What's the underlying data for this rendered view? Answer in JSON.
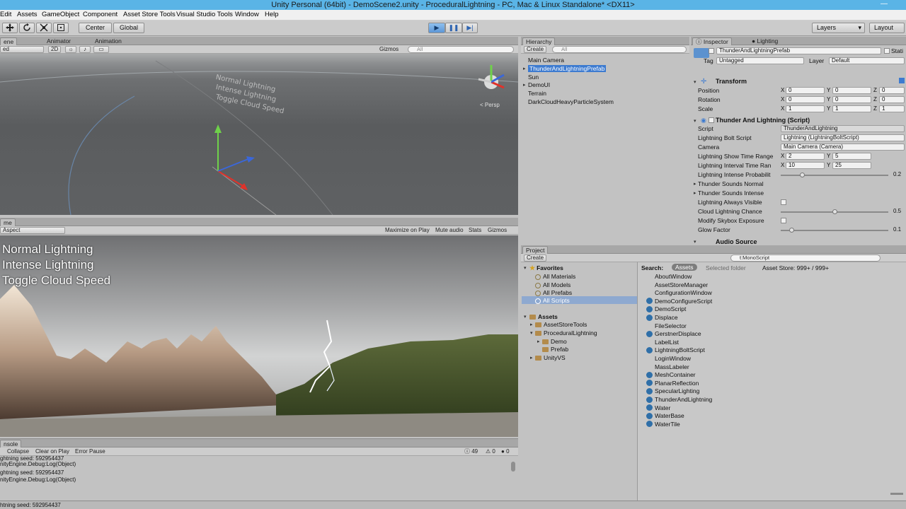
{
  "window": {
    "title": "Unity Personal (64bit) - DemoScene2.unity - ProceduralLightning - PC, Mac & Linux Standalone* <DX11>",
    "minimize": "—"
  },
  "menu": [
    "Edit",
    "Assets",
    "GameObject",
    "Component",
    "Asset Store Tools",
    "Visual Studio Tools",
    "Window",
    "Help"
  ],
  "toolbar": {
    "pivot": "Center",
    "space": "Global",
    "layers": "Layers",
    "layout": "Layout",
    "play_icon": "▶",
    "pause_icon": "❚❚",
    "step_icon": "▶|"
  },
  "scene": {
    "tabs": [
      "ene",
      "Animator",
      "Animation"
    ],
    "shading": "ed",
    "mode_2d": "2D",
    "gizmos": "Gizmos",
    "search_placeholder": "All",
    "labels": [
      "Normal Lightning",
      "Intense Lightning",
      "Toggle Cloud Speed"
    ],
    "persp": "< Persp"
  },
  "game": {
    "tab": "me",
    "aspect": "Aspect",
    "options": [
      "Maximize on Play",
      "Mute audio",
      "Stats",
      "Gizmos"
    ],
    "overlay": [
      "Normal Lightning",
      "Intense Lightning",
      "Toggle Cloud Speed"
    ]
  },
  "console": {
    "tab": "nsole",
    "buttons": [
      "Collapse",
      "Clear on Play",
      "Error Pause"
    ],
    "counts": {
      "info": "49",
      "warn": "0",
      "error": "0"
    },
    "lines": [
      "ghtning seed: 592954437",
      "nityEngine.Debug:Log(Object)",
      "ghtning seed: 592954437",
      "nityEngine.Debug:Log(Object)"
    ],
    "status": "htning seed: 592954437"
  },
  "hierarchy": {
    "tab": "Hierarchy",
    "create": "Create",
    "search_placeholder": "All",
    "items": [
      "Main Camera",
      "ThunderAndLightningPrefab",
      "Sun",
      "DemoUI",
      "Terrain",
      "DarkCloudHeavyParticleSystem"
    ],
    "selected_index": 1
  },
  "inspector": {
    "tabs": [
      "Inspector",
      "Lighting"
    ],
    "object_name": "ThunderAndLightningPrefab",
    "static": "Stati",
    "tag_label": "Tag",
    "tag_value": "Untagged",
    "layer_label": "Layer",
    "layer_value": "Default",
    "transform": {
      "header": "Transform",
      "rows": [
        {
          "label": "Position",
          "x": "0",
          "y": "0",
          "z": "0"
        },
        {
          "label": "Rotation",
          "x": "0",
          "y": "0",
          "z": "0"
        },
        {
          "label": "Scale",
          "x": "1",
          "y": "1",
          "z": "1"
        }
      ]
    },
    "script_component": {
      "header": "Thunder And Lightning (Script)",
      "script_label": "Script",
      "script_value": "ThunderAndLightning",
      "bolt_label": "Lightning Bolt Script",
      "bolt_value": "Lightning (LightningBoltScript)",
      "camera_label": "Camera",
      "camera_value": "Main Camera (Camera)",
      "show_time_label": "Lightning Show Time Range",
      "show_time_x": "2",
      "show_time_y": "5",
      "interval_label": "Lightning Interval Time Ran",
      "interval_x": "10",
      "interval_y": "25",
      "intense_prob_label": "Lightning Intense Probabilit",
      "intense_prob_value": "0.2",
      "intense_prob_fraction": 0.2,
      "sounds_normal_label": "Thunder Sounds Normal",
      "sounds_intense_label": "Thunder Sounds Intense",
      "always_visible_label": "Lightning Always Visible",
      "cloud_chance_label": "Cloud Lightning Chance",
      "cloud_chance_value": "0.5",
      "cloud_chance_fraction": 0.5,
      "skybox_label": "Modify Skybox Exposure",
      "glow_label": "Glow Factor",
      "glow_value": "0.1",
      "glow_fraction": 0.1
    },
    "audio_header": "Audio Source",
    "xlabel": "X",
    "ylabel": "Y",
    "zlabel": "Z"
  },
  "project": {
    "tab": "Project",
    "create": "Create",
    "search_value": "t:MonoScript",
    "favorites": {
      "header": "Favorites",
      "items": [
        "All Materials",
        "All Models",
        "All Prefabs",
        "All Scripts"
      ],
      "selected_index": 3
    },
    "assets": {
      "header": "Assets",
      "folders": [
        "AssetStoreTools",
        "ProceduralLightning",
        "Demo",
        "Prefab",
        "UnityVS"
      ]
    },
    "search_bar": {
      "label": "Search:",
      "assets": "Assets",
      "selected_folder": "Selected folder",
      "asset_store": "Asset Store: 999+ / 999+"
    },
    "files": [
      {
        "name": "AboutWindow",
        "cs": false
      },
      {
        "name": "AssetStoreManager",
        "cs": false
      },
      {
        "name": "ConfigurationWindow",
        "cs": false
      },
      {
        "name": "DemoConfigureScript",
        "cs": true
      },
      {
        "name": "DemoScript",
        "cs": true
      },
      {
        "name": "Displace",
        "cs": true
      },
      {
        "name": "FileSelector",
        "cs": false
      },
      {
        "name": "GerstnerDisplace",
        "cs": true
      },
      {
        "name": "LabelList",
        "cs": false
      },
      {
        "name": "LightningBoltScript",
        "cs": true
      },
      {
        "name": "LoginWindow",
        "cs": false
      },
      {
        "name": "MassLabeler",
        "cs": false
      },
      {
        "name": "MeshContainer",
        "cs": true
      },
      {
        "name": "PlanarReflection",
        "cs": true
      },
      {
        "name": "SpecularLighting",
        "cs": true
      },
      {
        "name": "ThunderAndLightning",
        "cs": true
      },
      {
        "name": "Water",
        "cs": true
      },
      {
        "name": "WaterBase",
        "cs": true
      },
      {
        "name": "WaterTile",
        "cs": true
      }
    ]
  },
  "colors": {
    "title_bar": "#5ab4e6",
    "selection": "#3d7bd0",
    "panel": "#c2c2c2",
    "play_active": "#5c96d6"
  }
}
